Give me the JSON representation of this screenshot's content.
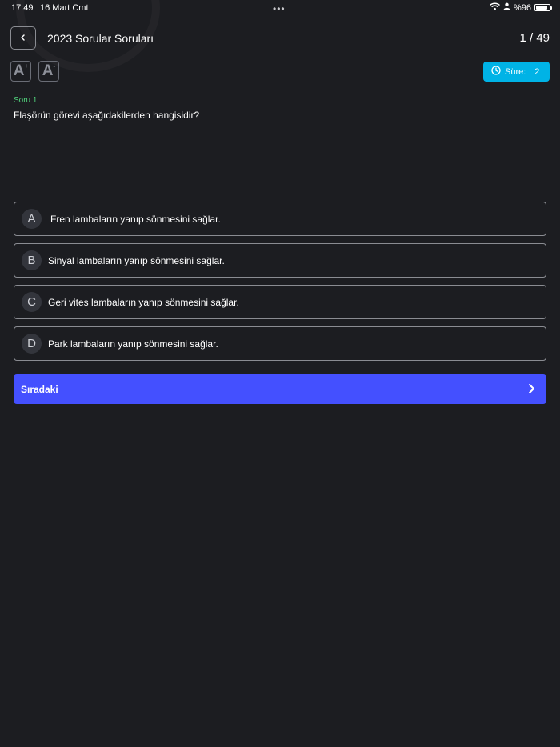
{
  "status_bar": {
    "time": "17:49",
    "date": "16 Mart Cmt",
    "dots": "•••",
    "battery": "%96"
  },
  "header": {
    "title": "2023 Sorular Soruları",
    "counter": "1 / 49"
  },
  "font_controls": {
    "increase_label": "A",
    "increase_mark": "+",
    "decrease_label": "A",
    "decrease_mark": "-"
  },
  "timer": {
    "label": "Süre:",
    "value": "2",
    "color": "#00b3e6"
  },
  "question": {
    "label": "Soru 1",
    "text": "Flaşörün görevi aşağıdakilerden hangisidir?"
  },
  "options": [
    {
      "letter": "A",
      "text": "Fren lambaların yanıp sönmesini sağlar."
    },
    {
      "letter": "B",
      "text": "Sinyal lambaların yanıp sönmesini sağlar."
    },
    {
      "letter": "C",
      "text": "Geri vites lambaların yanıp sönmesini sağlar."
    },
    {
      "letter": "D",
      "text": "Park lambaların yanıp sönmesini sağlar."
    }
  ],
  "next_button": {
    "label": "Sıradaki",
    "color": "#4450ff"
  },
  "icons": {
    "back": "chevron-left-icon",
    "timer": "clock-icon",
    "next": "chevron-right-icon",
    "wifi": "wifi-icon",
    "person": "person-icon",
    "battery": "battery-icon"
  }
}
